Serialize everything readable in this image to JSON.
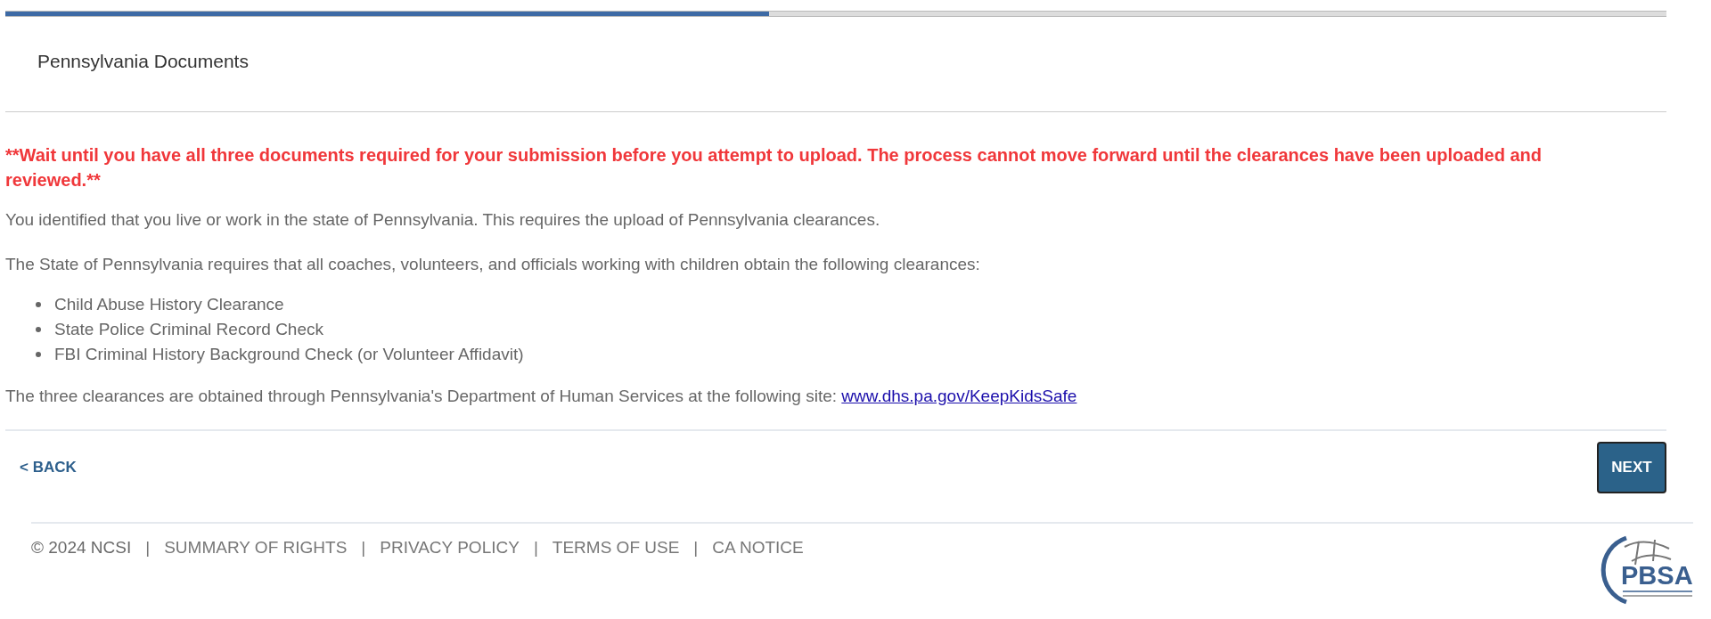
{
  "progress": {
    "level": 0.46
  },
  "title": "Pennsylvania Documents",
  "warning": "**Wait until you have all three documents required for your submission before you attempt to upload. The process cannot move forward until the clearances have been uploaded and reviewed.**",
  "paragraphs": [
    "You identified that you live or work in the state of Pennsylvania. This requires the upload of Pennsylvania clearances.",
    "The State of Pennsylvania requires that all coaches, volunteers, and officials working with children obtain the following clearances:"
  ],
  "clearances": [
    "Child Abuse History Clearance",
    "State Police Criminal Record Check",
    "FBI Criminal History Background Check (or Volunteer Affidavit)"
  ],
  "site_note": {
    "text": "The three clearances are obtained through Pennsylvania's Department of Human Services at the following site:",
    "link": "www.dhs.pa.gov/KeepKidsSafe"
  },
  "back_button": "< BACK",
  "next_button": "NEXT",
  "footer": [
    {
      "kind": "text",
      "text": "© 2024 NCSI"
    },
    {
      "kind": "separator",
      "text": "|"
    },
    {
      "kind": "link",
      "text": "SUMMARY OF RIGHTS"
    },
    {
      "kind": "separator",
      "text": "|"
    },
    {
      "kind": "link",
      "text": "PRIVACY POLICY"
    },
    {
      "kind": "separator",
      "text": "|"
    },
    {
      "kind": "link",
      "text": "TERMS OF USE"
    },
    {
      "kind": "separator",
      "text": "|"
    },
    {
      "kind": "link",
      "text": "CA NOTICE"
    }
  ],
  "logo": {
    "text": "PBSA"
  }
}
